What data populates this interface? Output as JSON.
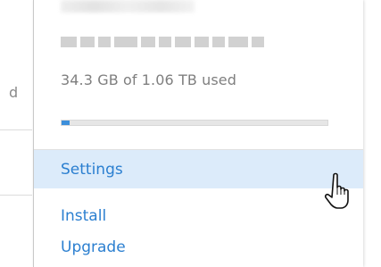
{
  "storage": {
    "usage_text": "34.3 GB of 1.06 TB used",
    "used_fraction": 0.03
  },
  "background": {
    "partial_text": "d"
  },
  "menu": {
    "items": [
      {
        "label": "Settings",
        "state": "hover"
      },
      {
        "label": "Install"
      },
      {
        "label": "Upgrade"
      }
    ]
  },
  "colors": {
    "link": "#2b7fd0",
    "hover_bg": "#dcebfa",
    "progress_fill": "#3c8fdb"
  },
  "icons": {
    "cursor": "hand-pointer-icon"
  }
}
